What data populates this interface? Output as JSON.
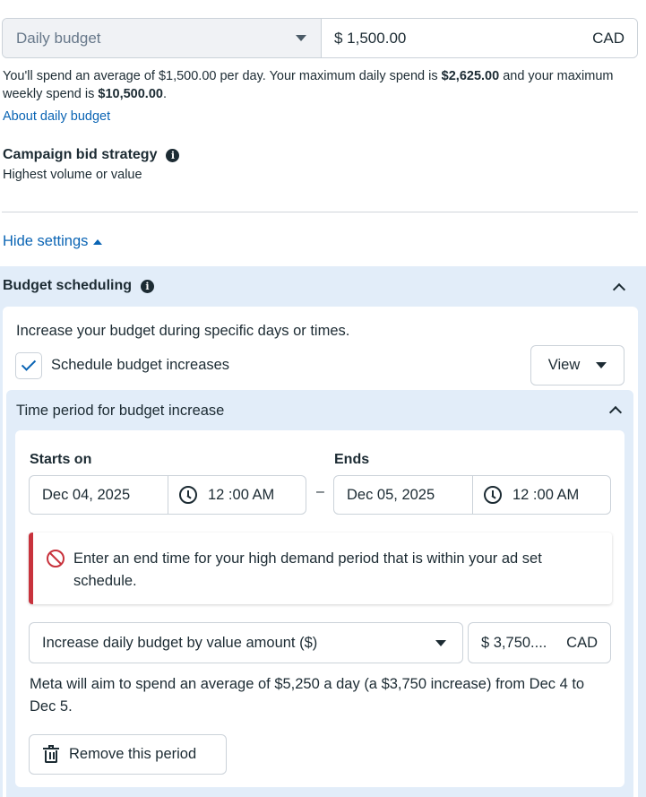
{
  "budget": {
    "type_label": "Daily budget",
    "amount": "$ 1,500.00",
    "currency": "CAD",
    "spend_text_1": "You'll spend an average of $1,500.00 per day. Your maximum daily spend is ",
    "max_daily": "$2,625.00",
    "spend_text_2": " and your maximum weekly spend is ",
    "max_weekly": "$10,500.00",
    "spend_text_3": ".",
    "about_link": "About daily budget"
  },
  "bid_strategy": {
    "title": "Campaign bid strategy",
    "value": "Highest volume or value"
  },
  "hide_settings": "Hide settings",
  "scheduling": {
    "title": "Budget scheduling",
    "description": "Increase your budget during specific days or times.",
    "checkbox_label": "Schedule budget increases",
    "checkbox_checked": true,
    "view_label": "View",
    "period": {
      "title": "Time period for budget increase",
      "starts_label": "Starts on",
      "ends_label": "Ends",
      "start_date": "Dec 04, 2025",
      "start_time": "12 :00 AM",
      "end_date": "Dec 05, 2025",
      "end_time": "12 :00 AM",
      "dash": "–",
      "error": "Enter an end time for your high demand period that is within your ad set schedule.",
      "increase_type": "Increase daily budget by value amount ($)",
      "increase_amount": "$ 3,750....",
      "increase_currency": "CAD",
      "aim_text": "Meta will aim to spend an average of $5,250 a day (a $3,750 increase) from Dec 4 to Dec 5.",
      "remove_label": "Remove this period"
    }
  },
  "colors": {
    "link": "#0a64b4",
    "panel_bg": "#e2edf9",
    "error": "#c8323c"
  }
}
